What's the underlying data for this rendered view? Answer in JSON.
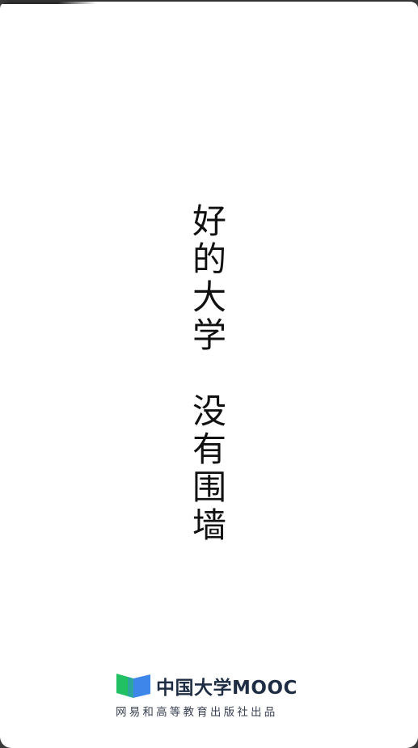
{
  "splash": {
    "slogan_line1": "好的大学",
    "slogan_line2": "没有围墙"
  },
  "brand": {
    "name": "中国大学MOOC",
    "subtitle": "网易和高等教育出版社出品",
    "logo_icon": "open-book-icon",
    "colors": {
      "green": "#21c063",
      "blue": "#3f86ea",
      "text": "#1f2d44"
    }
  }
}
